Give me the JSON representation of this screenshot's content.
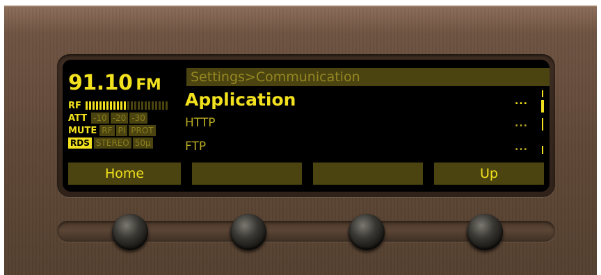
{
  "status": {
    "frequency": "91.10",
    "band": "FM",
    "rf_label": "RF",
    "rf_level_segments": 12,
    "rf_total_segments": 24,
    "att_label": "ATT",
    "att_options": [
      "-10",
      "-20",
      "-30"
    ],
    "mute_label": "MUTE",
    "mute_flags": [
      "RF",
      "PI",
      "PROT"
    ],
    "rds_label": "RDS",
    "stereo_label": "STEREO",
    "deemphasis": "50μ"
  },
  "breadcrumb": "Settings>Communication",
  "menu": {
    "title": "Application",
    "title_more": "...",
    "items": [
      {
        "label": "HTTP",
        "more": "..."
      },
      {
        "label": "FTP",
        "more": "..."
      }
    ]
  },
  "softkeys": [
    "Home",
    "",
    "",
    "Up"
  ],
  "colors": {
    "lcd_text": "#f2e11e",
    "lcd_dim": "#4b4410",
    "lcd_background": "#000000",
    "panel": "#5e4636"
  }
}
